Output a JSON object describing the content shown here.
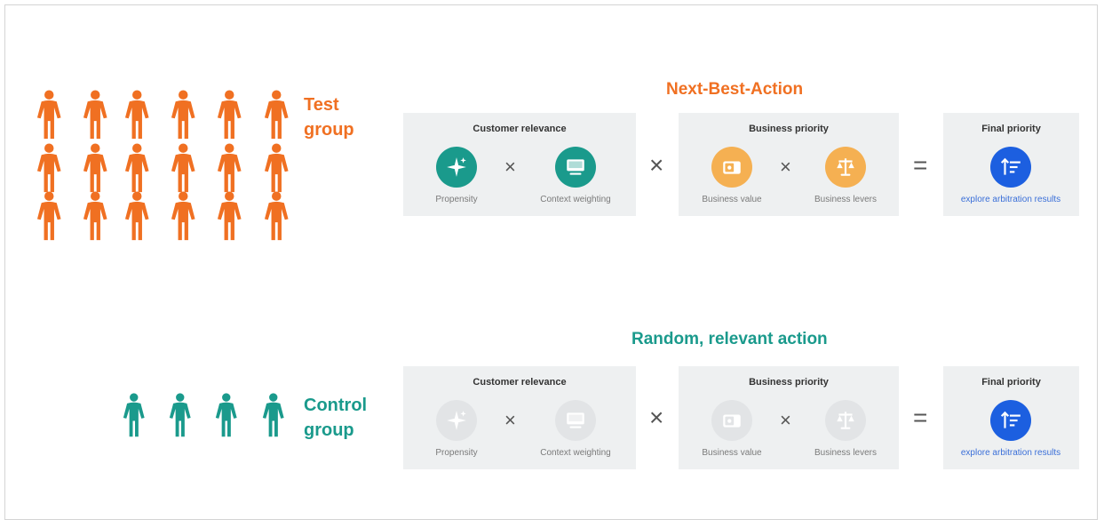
{
  "test_group": {
    "label_line1": "Test",
    "label_line2": "group",
    "color": "#f07022",
    "count": 18
  },
  "control_group": {
    "label_line1": "Control",
    "label_line2": "group",
    "color": "#1a9a8c",
    "count": 4
  },
  "nba_row": {
    "title": "Next-Best-Action",
    "title_color": "#f07022",
    "customer_relevance": {
      "title": "Customer relevance",
      "item1": {
        "label": "Propensity",
        "icon": "sparkle-icon",
        "color": "#1a9a8c"
      },
      "item2": {
        "label": "Context weighting",
        "icon": "monitor-icon",
        "color": "#1a9a8c"
      }
    },
    "business_priority": {
      "title": "Business priority",
      "item1": {
        "label": "Business value",
        "icon": "wallet-icon",
        "color": "#f5b052"
      },
      "item2": {
        "label": "Business levers",
        "icon": "scales-icon",
        "color": "#f5b052"
      }
    },
    "final_priority": {
      "title": "Final priority",
      "item": {
        "label": "explore arbitration results",
        "icon": "sort-icon",
        "color": "#1c5fe0"
      }
    }
  },
  "random_row": {
    "title": "Random, relevant action",
    "title_color": "#1a9a8c",
    "customer_relevance": {
      "title": "Customer relevance",
      "item1": {
        "label": "Propensity",
        "icon": "sparkle-icon",
        "color": "#e2e4e6"
      },
      "item2": {
        "label": "Context weighting",
        "icon": "monitor-icon",
        "color": "#e2e4e6"
      }
    },
    "business_priority": {
      "title": "Business priority",
      "item1": {
        "label": "Business value",
        "icon": "wallet-icon",
        "color": "#e2e4e6"
      },
      "item2": {
        "label": "Business levers",
        "icon": "scales-icon",
        "color": "#e2e4e6"
      }
    },
    "final_priority": {
      "title": "Final priority",
      "item": {
        "label": "explore arbitration results",
        "icon": "sort-icon",
        "color": "#1c5fe0"
      }
    }
  },
  "operators": {
    "times": "×",
    "equals": "="
  }
}
